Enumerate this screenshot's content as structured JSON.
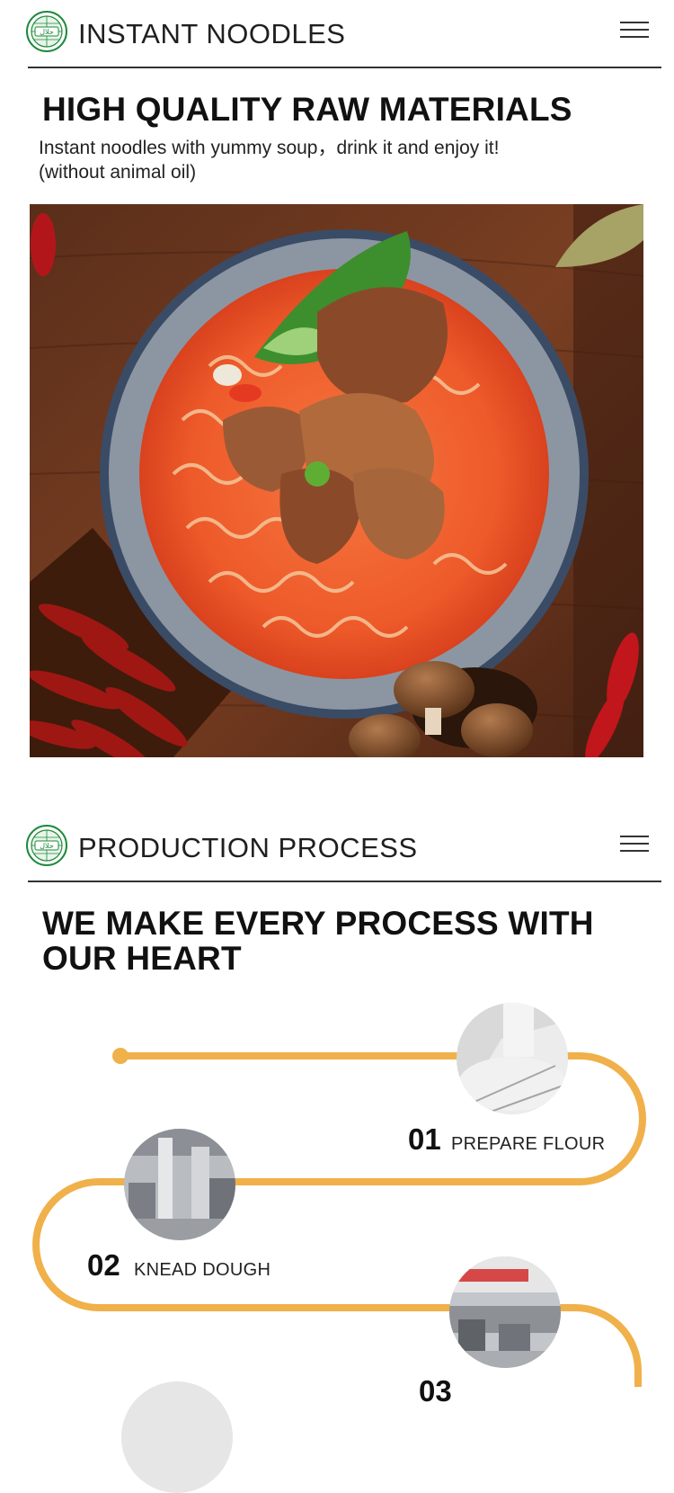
{
  "section1": {
    "title": "INSTANT NOODLES",
    "headline": "HIGH QUALITY RAW MATERIALS",
    "description_line1": "Instant noodles with yummy soup，drink it and enjoy it!",
    "description_line2": "(without animal oil)"
  },
  "section2": {
    "title": "PRODUCTION PROCESS",
    "headline_line1": "WE MAKE EVERY PROCESS WITH",
    "headline_line2": "OUR HEART"
  },
  "logo": {
    "text": "حلال",
    "color": "#1d8a3a"
  },
  "steps": [
    {
      "number": "01",
      "label": "PREPARE FLOUR"
    },
    {
      "number": "02",
      "label": "KNEAD DOUGH"
    },
    {
      "number": "03",
      "label": ""
    }
  ],
  "colors": {
    "accent": "#f0b04a",
    "text": "#1a1a1a"
  },
  "icons": {
    "menu": "hamburger-menu-icon",
    "logo": "halal-logo-icon"
  }
}
